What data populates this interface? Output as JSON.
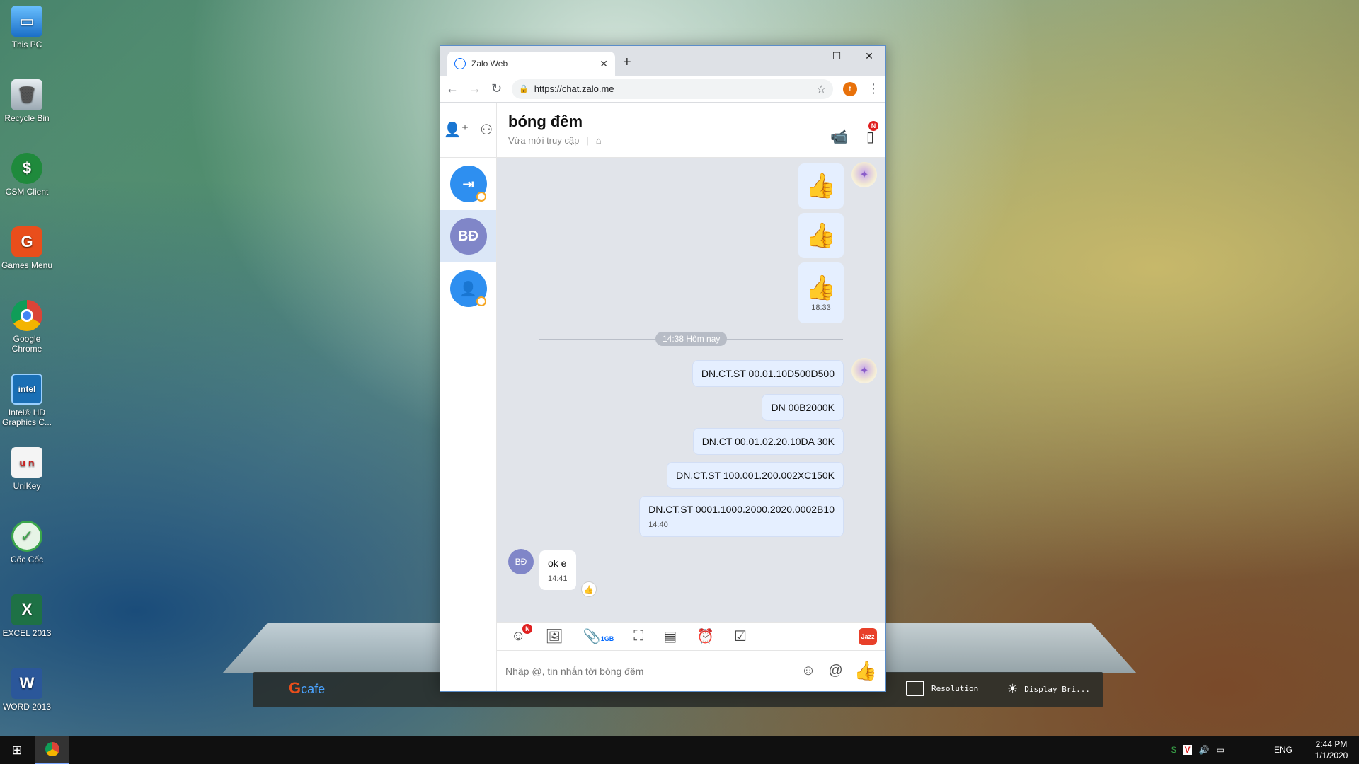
{
  "desktop": {
    "icons": [
      {
        "label": "This PC",
        "icon": "computer-icon"
      },
      {
        "label": "Recycle Bin",
        "icon": "recycle-bin-icon"
      },
      {
        "label": "CSM Client",
        "icon": "dollar-icon"
      },
      {
        "label": "Games Menu",
        "icon": "g-logo-icon"
      },
      {
        "label": "Google Chrome",
        "icon": "chrome-icon"
      },
      {
        "label": "Intel® HD Graphics C...",
        "icon": "intel-icon"
      },
      {
        "label": "UniKey",
        "icon": "unikey-icon"
      },
      {
        "label": "Cốc Cốc",
        "icon": "coccoc-icon"
      },
      {
        "label": "EXCEL 2013",
        "icon": "excel-icon"
      },
      {
        "label": "WORD 2013",
        "icon": "word-icon"
      }
    ],
    "shelf": {
      "items": [
        {
          "label": "Resolution"
        },
        {
          "label": "Display Bri..."
        }
      ],
      "logo": "cafe"
    }
  },
  "browser": {
    "tab_title": "Zalo Web",
    "url": "https://chat.zalo.me",
    "profile_initial": "t"
  },
  "zalo": {
    "chat_title": "bóng đêm",
    "status": "Vừa mới truy cập",
    "contact_initials": "BĐ",
    "messages": {
      "sticker_time": "18:33",
      "separator": "14:38 Hôm nay",
      "sent": [
        "DN.CT.ST 00.01.10D500D500",
        "DN 00B2000K",
        "DN.CT 00.01.02.20.10DA 30K",
        "DN.CT.ST 100.001.200.002XC150K",
        "DN.CT.ST 0001.1000.2000.2020.0002B10"
      ],
      "sent_time": "14:40",
      "received": "ok e",
      "received_time": "14:41"
    },
    "toolbar": {
      "attach_size": "1GB",
      "sticker_badge": "N",
      "jazz": "Jazz"
    },
    "composer_placeholder": "Nhập @, tin nhắn tới bóng đêm",
    "header_badge": "N"
  },
  "taskbar": {
    "lang": "ENG",
    "time": "2:44 PM",
    "date": "1/1/2020"
  }
}
